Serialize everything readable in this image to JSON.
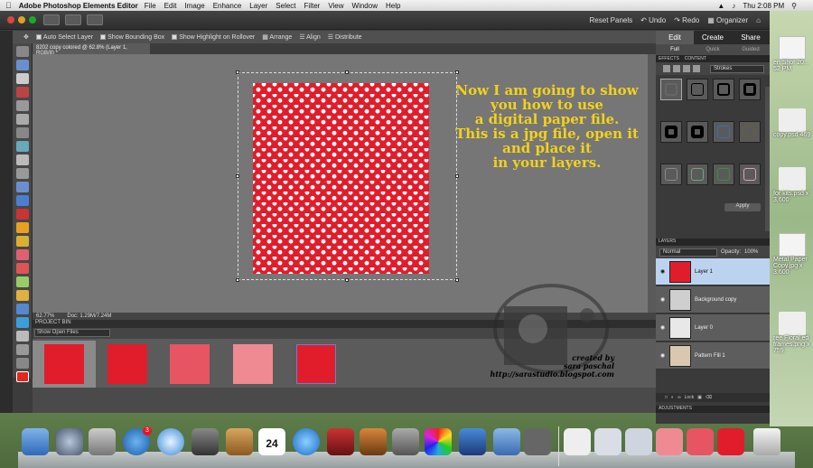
{
  "mac_menubar": {
    "app_name": "Adobe Photoshop Elements Editor",
    "menus": [
      "File",
      "Edit",
      "Image",
      "Enhance",
      "Layer",
      "Select",
      "Filter",
      "View",
      "Window",
      "Help"
    ],
    "clock": "Thu 2:08 PM"
  },
  "window_toolbar": {
    "reset_panels": "Reset Panels",
    "undo": "Undo",
    "redo": "Redo",
    "organizer": "Organizer"
  },
  "options_bar": {
    "auto_select_layer": "Auto Select Layer",
    "show_bounding_box": "Show Bounding Box",
    "show_highlight": "Show Highlight on Rollover",
    "arrange": "Arrange",
    "align": "Align",
    "distribute": "Distribute"
  },
  "document": {
    "tab_title": "8202 copy colored @ 62.8% (Layer 1, RGB/8) *",
    "zoom": "62.77%",
    "doc_size": "Doc: 1.29M/7.24M",
    "pattern_color": "#e11d2b"
  },
  "overlay_text": [
    "Now I am going to show",
    "you how to use",
    "a digital paper file.",
    "This is a jpg file, open it",
    "and place it",
    "in your layers."
  ],
  "credit": [
    "created by",
    "sara paschal",
    "http://sarastudio.blogspot.com"
  ],
  "project_bin": {
    "header": "PROJECT BIN",
    "dropdown": "Show Open Files",
    "thumbnails": [
      {
        "color": "#e11d2b",
        "pattern": "hearts"
      },
      {
        "color": "#e11d2b",
        "pattern": "solid"
      },
      {
        "color": "#e65561",
        "pattern": "hearts"
      },
      {
        "color": "#f08a92",
        "pattern": "hearts"
      },
      {
        "color": "#e11d2b",
        "pattern": "dots"
      }
    ]
  },
  "panel": {
    "mode_tabs": [
      "Edit",
      "Create",
      "Share"
    ],
    "sub_tabs": [
      "Full",
      "Quick",
      "Guided"
    ],
    "effects_tabs": [
      "EFFECTS",
      "CONTENT"
    ],
    "strokes_select": "Strokes",
    "apply_button": "Apply",
    "layers_header": "LAYERS",
    "blend_mode": "Normal",
    "opacity_label": "Opacity:",
    "opacity_value": "100%",
    "layers": [
      {
        "name": "Layer 1",
        "active": true
      },
      {
        "name": "Background copy",
        "active": false
      },
      {
        "name": "Layer 0",
        "active": false
      },
      {
        "name": "Pattern Fill 1",
        "active": false
      }
    ],
    "lock_label": "Lock",
    "adjustments_header": "ADJUSTMENTS"
  },
  "desktop_icons": [
    {
      "label": "en Shot 20... 52 PM"
    },
    {
      "label": "copy.psd 469"
    },
    {
      "label": "for kits.psd x 3,600"
    },
    {
      "label": "Metal Paper Copy.jpg x 3,600"
    },
    {
      "label": "ree Floral ed frames.png x 759"
    }
  ],
  "dock": {
    "app_store_badge": "3",
    "calendar_day": "24"
  }
}
